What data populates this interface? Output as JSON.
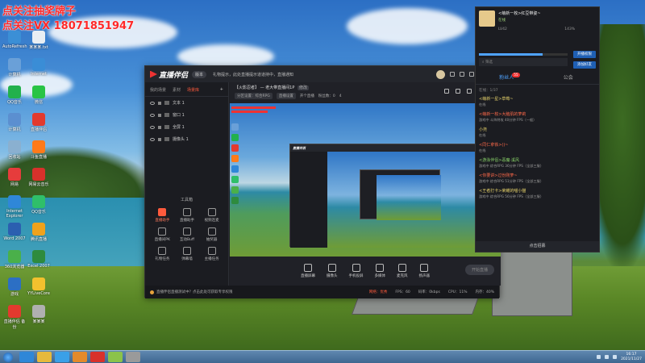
{
  "overlay": {
    "line1": "点关注抽奖牌子",
    "line2": "点关注VX 18071851947"
  },
  "desktop_icons": [
    {
      "label": "AutoRefresh",
      "color": "#3b8fd6"
    },
    {
      "label": "某某某.txt",
      "color": "#e9eef3"
    },
    {
      "label": "计算机",
      "color": "#6aa0d8"
    },
    {
      "label": "Internet",
      "color": "#3a8dd6"
    },
    {
      "label": "QQ音乐",
      "color": "#22b14c"
    },
    {
      "label": "微信",
      "color": "#28c445"
    },
    {
      "label": "计算机",
      "color": "#5b8fd0"
    },
    {
      "label": "直播伴侣",
      "color": "#e33a2e"
    },
    {
      "label": "回收站",
      "color": "#8ab0d0"
    },
    {
      "label": "斗鱼直播",
      "color": "#ff7a1a"
    },
    {
      "label": "网易",
      "color": "#e63c3c"
    },
    {
      "label": "网易云音乐",
      "color": "#d8312b"
    },
    {
      "label": "Internet Explorer",
      "color": "#2f87d8"
    },
    {
      "label": "QQ音乐",
      "color": "#2fbf6a"
    },
    {
      "label": "Word 2007",
      "color": "#2b5fb0"
    },
    {
      "label": "腾讯直播",
      "color": "#f0a21c"
    },
    {
      "label": "360浏览器",
      "color": "#4ab04a"
    },
    {
      "label": "Excel 2007",
      "color": "#2e8b3e"
    },
    {
      "label": "游戏",
      "color": "#2c6fc4"
    },
    {
      "label": "YYLiveCore",
      "color": "#f2c12e"
    },
    {
      "label": "直播伴侣 备份",
      "color": "#e33a2e"
    },
    {
      "label": "某某某",
      "color": "#b0b0b0"
    }
  ],
  "app": {
    "name": "直播伴侣",
    "version": "版本",
    "notice": "礼物提示，此处直播提示道道持中，直播通知",
    "left_tabs": [
      "我的场景",
      "素材",
      "场景库"
    ],
    "scenes": [
      "文本 1",
      "窗口 1",
      "全屏 1",
      "摄像头 1"
    ],
    "tools_title": "工具箱",
    "tools": [
      {
        "label": "直播助手",
        "hot": true
      },
      {
        "label": "直播助手",
        "hot": false
      },
      {
        "label": "视频连麦",
        "hot": false
      },
      {
        "label": "直播间PK",
        "hot": false
      },
      {
        "label": "互动Buff",
        "hot": false
      },
      {
        "label": "抽奖器",
        "hot": false
      },
      {
        "label": "礼物任务",
        "hot": false
      },
      {
        "label": "弹幕墙",
        "hot": false
      },
      {
        "label": "主播任务",
        "hot": false
      }
    ],
    "room_title": "【火影忍者】 — 老大带直播间1P",
    "room_tag": "修改",
    "room_meta": [
      "分区设置：综合RPG",
      "直播设置",
      "开个直播",
      "粉丝数：0",
      "4"
    ],
    "bottom_buttons": [
      "直播屏幕",
      "摄像头",
      "手机投屏",
      "多媒体",
      "麦克风",
      "扬声器"
    ],
    "go_live": "开始直播",
    "status_text": "直播伴侣直播测试中？点击此处可获取专享权限",
    "status_right": [
      "网络：优秀",
      "FPS：60",
      "码率：0kbps",
      "CPU：11%",
      "内存：40%"
    ]
  },
  "chat": {
    "user_name": "<萌新一枚>红豆带姿~",
    "user_status": "在线",
    "level_text": "LV42",
    "level_percent": "143%",
    "level_fill": 0.72,
    "btn_top": "开播权限",
    "btn_mid": "添加好友",
    "search_placeholder": "筛选",
    "tabs": [
      "粉丝人",
      "公会"
    ],
    "tab_badge": "55",
    "online": "在线：1/37",
    "fans": [
      {
        "name": "<萌新一星>草莓~",
        "detail": "在线",
        "tone": "gold"
      },
      {
        "name": "<萌新一枚>大脑肌的萝莉",
        "detail": "游戏中 斗阵特攻 40分钟 FPS（一般）",
        "tone": "red"
      },
      {
        "name": "小尧",
        "detail": "在线",
        "tone": "gold"
      },
      {
        "name": "<同仁拿铁>()~",
        "detail": "在线",
        "tone": "red"
      },
      {
        "name": "<游泳伴侣>恶魔·溪风",
        "detail": "游戏中 综合RPG 36分钟 FPS（全部三服）",
        "tone": "grn"
      },
      {
        "name": "<你要讲>过份刚萝~",
        "detail": "游戏中 综合RPG 51分钟 FPS（全部三服）",
        "tone": "red"
      },
      {
        "name": "<王者打卡>荣耀的喵小猫",
        "detail": "游戏中 综合RPG 56分钟 FPS（全部三服）",
        "tone": "gold"
      }
    ],
    "footer": "点击招募"
  },
  "taskbar": {
    "clock_time": "16:17",
    "clock_date": "2021/11/27"
  }
}
